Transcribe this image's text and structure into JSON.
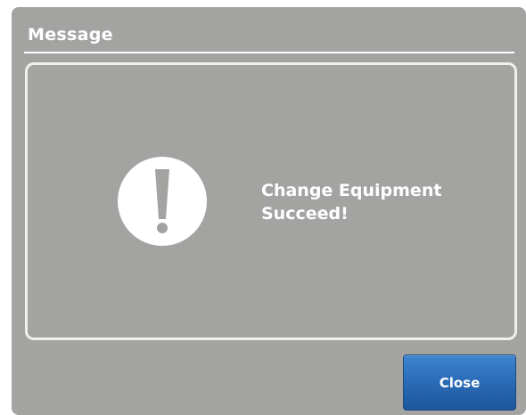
{
  "dialog": {
    "title": "Message",
    "icon": "exclamation-circle-icon",
    "message_line1": "Change Equipment",
    "message_line2": "Succeed!",
    "close_label": "Close"
  },
  "colors": {
    "dialog_background": "#a3a3a2",
    "panel_border": "#f0f0ef",
    "text": "#ffffff",
    "button_accent": "#2b6db8"
  }
}
